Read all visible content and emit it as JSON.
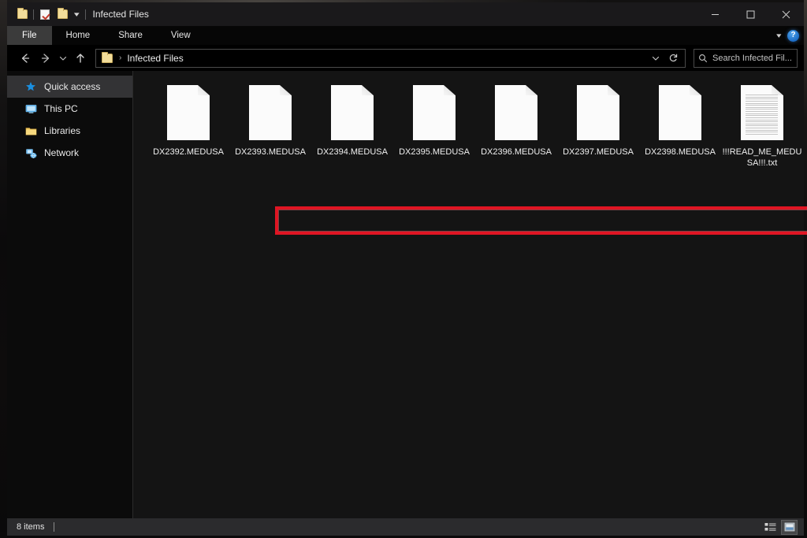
{
  "window": {
    "title": "Infected Files",
    "quick_access_toolbar": [
      {
        "icon": "folder-icon",
        "name": "explorer-folder-icon"
      },
      {
        "icon": "properties-icon",
        "name": "properties-button"
      },
      {
        "icon": "new-folder-icon",
        "name": "new-folder-button"
      },
      {
        "icon": "chevron-down-icon",
        "name": "customize-qat-button"
      }
    ],
    "controls": {
      "minimize": "Minimize",
      "maximize": "Maximize",
      "close": "Close"
    }
  },
  "ribbon": {
    "tabs": [
      {
        "label": "File",
        "selected": true
      },
      {
        "label": "Home",
        "selected": false
      },
      {
        "label": "Share",
        "selected": false
      },
      {
        "label": "View",
        "selected": false
      }
    ],
    "expand_label": "Expand the Ribbon",
    "help_label": "?"
  },
  "navbar": {
    "back_label": "Back",
    "forward_label": "Forward",
    "recent_label": "Recent locations",
    "up_label": "Up",
    "breadcrumb": "Infected Files",
    "breadcrumb_separator": "›",
    "previous_locations_label": "Previous locations",
    "refresh_label": "Refresh",
    "search_placeholder": "Search Infected Fil..."
  },
  "sidebar": {
    "items": [
      {
        "label": "Quick access",
        "icon": "star-icon",
        "selected": true
      },
      {
        "label": "This PC",
        "icon": "monitor-icon",
        "selected": false
      },
      {
        "label": "Libraries",
        "icon": "folder-icon",
        "selected": false
      },
      {
        "label": "Network",
        "icon": "network-icon",
        "selected": false
      }
    ]
  },
  "content": {
    "files": [
      {
        "name": "DX2392.MEDUSA",
        "type": "encrypted"
      },
      {
        "name": "DX2393.MEDUSA",
        "type": "encrypted"
      },
      {
        "name": "DX2394.MEDUSA",
        "type": "encrypted"
      },
      {
        "name": "DX2395.MEDUSA",
        "type": "encrypted"
      },
      {
        "name": "DX2396.MEDUSA",
        "type": "encrypted"
      },
      {
        "name": "DX2397.MEDUSA",
        "type": "encrypted"
      },
      {
        "name": "DX2398.MEDUSA",
        "type": "encrypted"
      },
      {
        "name": "!!!READ_ME_MEDUSA!!!.txt",
        "type": "text"
      }
    ]
  },
  "annotation": {
    "color": "#e01523",
    "label": "encrypted-files-highlight"
  },
  "statusbar": {
    "item_count": "8 items",
    "views": [
      {
        "name": "details-view",
        "active": false
      },
      {
        "name": "large-icons-view",
        "active": true
      }
    ]
  }
}
